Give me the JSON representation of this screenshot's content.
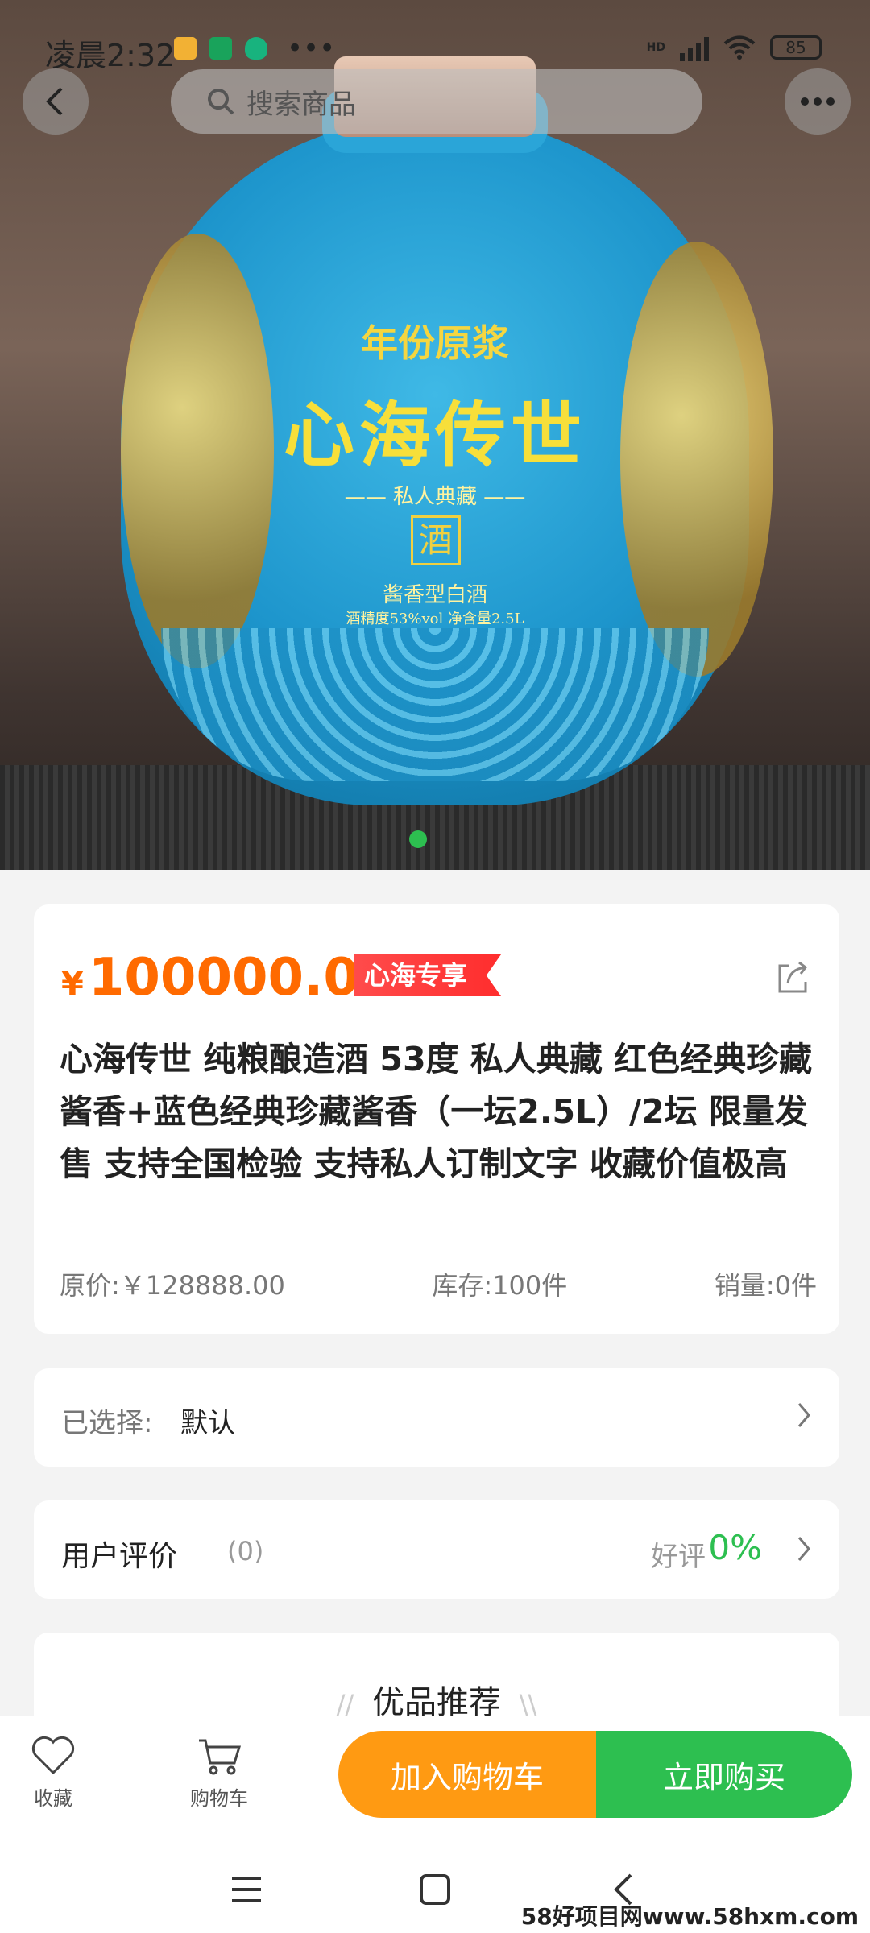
{
  "status_bar": {
    "time": "凌晨2:32",
    "more": "•••",
    "network": "HD",
    "battery": "85"
  },
  "nav": {
    "search_placeholder": "搜索商品"
  },
  "hero": {
    "label_top": "年份原浆",
    "label_main": "心海传世",
    "label_sub": "—— 私人典藏 ——",
    "label_seal": "酒",
    "label_kind": "酱香型白酒",
    "label_spec": "酒精度53%vol   净含量2.5L",
    "image_index": 1,
    "image_count": 1
  },
  "product": {
    "currency": "¥",
    "price": "100000.00",
    "promo_badge": "心海专享",
    "title": "心海传世 纯粮酿造酒 53度 私人典藏 红色经典珍藏酱香+蓝色经典珍藏酱香（一坛2.5L）/2坛 限量发售 支持全国检验 支持私人订制文字 收藏价值极高",
    "original_price": "原价:￥128888.00",
    "stock": "库存:100件",
    "sales": "销量:0件"
  },
  "selection": {
    "label": "已选择:",
    "value": "默认"
  },
  "reviews": {
    "title": "用户评价",
    "count": "(0)",
    "good_label": "好评",
    "good_rate": "0%"
  },
  "recommend": {
    "title": "优品推荐"
  },
  "action_bar": {
    "favorite_label": "收藏",
    "cart_label": "购物车",
    "add_to_cart": "加入购物车",
    "buy_now": "立即购买"
  },
  "watermark": "58好项目网www.58hxm.com",
  "colors": {
    "accent_orange": "#ff6a00",
    "cart_button": "#ff9a12",
    "buy_button": "#2dbf50",
    "badge_red": "#ff2d2d"
  }
}
